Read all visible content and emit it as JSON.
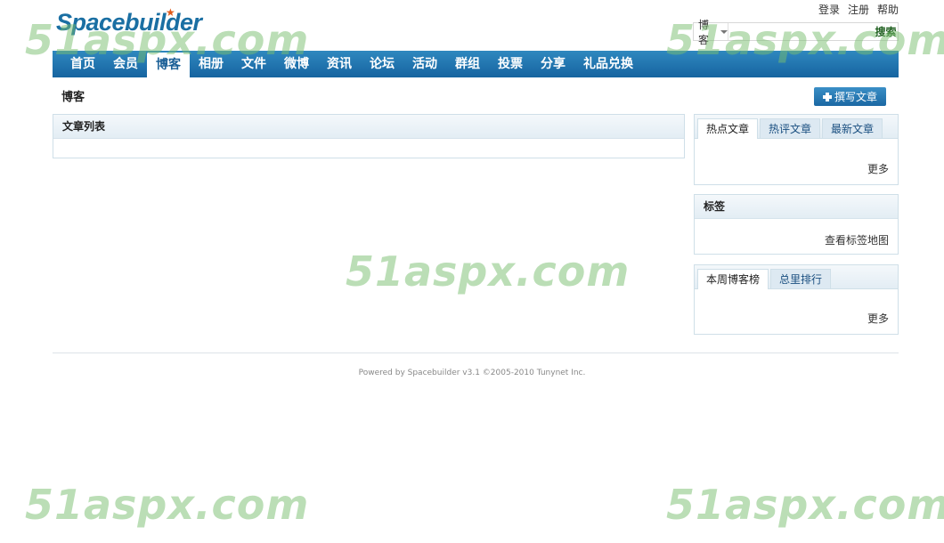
{
  "logo": {
    "text": "Spacebuilder"
  },
  "top_links": [
    "登录",
    "注册",
    "帮助"
  ],
  "search": {
    "scope": "博客",
    "placeholder": "",
    "button": "搜索"
  },
  "nav": {
    "items": [
      "首页",
      "会员",
      "博客",
      "相册",
      "文件",
      "微博",
      "资讯",
      "论坛",
      "活动",
      "群组",
      "投票",
      "分享",
      "礼品兑换"
    ],
    "active": "博客"
  },
  "page": {
    "title": "博客",
    "write_button": "撰写文章"
  },
  "article_list": {
    "title": "文章列表"
  },
  "hot_panel": {
    "tabs": [
      "热点文章",
      "热评文章",
      "最新文章"
    ],
    "more": "更多"
  },
  "tag_panel": {
    "title": "标签",
    "link": "查看标签地图"
  },
  "rank_panel": {
    "tabs": [
      "本周博客榜",
      "总里排行"
    ],
    "more": "更多"
  },
  "footer": {
    "text": "Powered by Spacebuilder v3.1 ©2005-2010 Tunynet Inc."
  },
  "watermark": {
    "text": "51aspx.com"
  },
  "colors": {
    "nav": "#1a6fa8",
    "accent": "#1a6fa3",
    "logo_star": "#e05a1a",
    "watermark": "#8cc880"
  }
}
